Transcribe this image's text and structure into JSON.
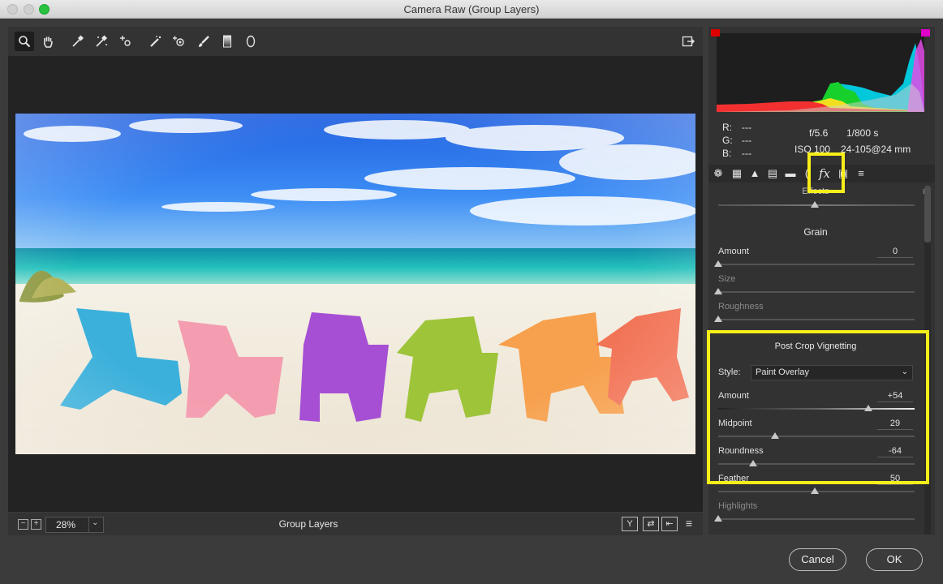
{
  "window": {
    "title": "Camera Raw (Group Layers)"
  },
  "toolbar": {
    "tools": [
      {
        "name": "zoom-tool",
        "icon": "magnifier-icon"
      },
      {
        "name": "hand-tool",
        "icon": "hand-icon"
      },
      {
        "name": "white-balance-tool",
        "icon": "eyedropper-icon"
      },
      {
        "name": "color-sampler-tool",
        "icon": "color-sampler-icon"
      },
      {
        "name": "targeted-adjustment-tool",
        "icon": "target-adjust-icon"
      },
      {
        "name": "spot-removal-tool",
        "icon": "spot-removal-icon"
      },
      {
        "name": "red-eye-tool",
        "icon": "red-eye-icon"
      },
      {
        "name": "adjustment-brush-tool",
        "icon": "brush-icon"
      },
      {
        "name": "graduated-filter-tool",
        "icon": "gradient-icon"
      },
      {
        "name": "radial-filter-tool",
        "icon": "ellipse-icon"
      }
    ],
    "fullscreen_icon": "fullscreen-icon"
  },
  "bottombar": {
    "zoom_out": "−",
    "zoom_in": "+",
    "zoom_value": "28%",
    "caption": "Group Layers",
    "view_buttons": [
      "Y",
      "⇄",
      "⇤",
      "≡"
    ]
  },
  "info": {
    "r_label": "R:",
    "r_value": "---",
    "g_label": "G:",
    "g_value": "---",
    "b_label": "B:",
    "b_value": "---",
    "aperture": "f/5.6",
    "shutter": "1/800 s",
    "iso": "ISO 100",
    "lens": "24-105@24 mm"
  },
  "panel": {
    "effects_header": "Effects",
    "grain": {
      "title": "Grain",
      "amount_label": "Amount",
      "amount_value": "0",
      "size_label": "Size",
      "roughness_label": "Roughness"
    },
    "vignetting": {
      "title": "Post Crop Vignetting",
      "style_label": "Style:",
      "style_value": "Paint Overlay",
      "amount_label": "Amount",
      "amount_value": "+54",
      "midpoint_label": "Midpoint",
      "midpoint_value": "29",
      "roundness_label": "Roundness",
      "roundness_value": "-64",
      "feather_label": "Feather",
      "feather_value": "50",
      "highlights_label": "Highlights"
    }
  },
  "buttons": {
    "cancel": "Cancel",
    "ok": "OK"
  },
  "colors": {
    "highlight": "#f6ee19",
    "accent_red": "#e00000",
    "accent_magenta": "#e000c8"
  }
}
